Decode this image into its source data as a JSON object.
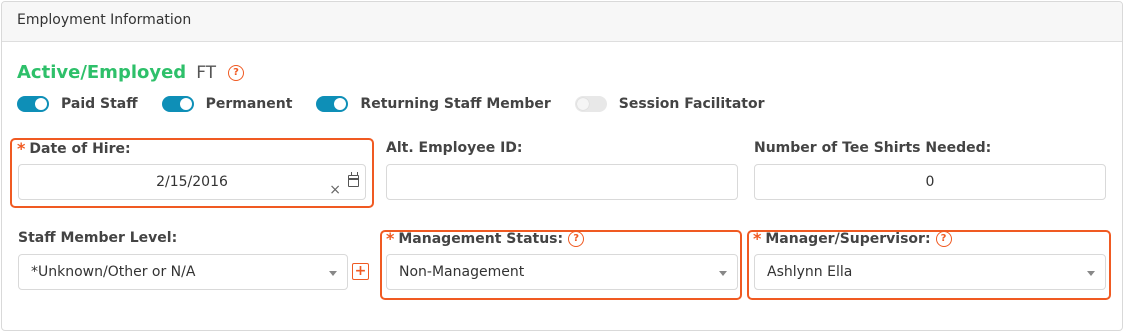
{
  "card": {
    "title": "Employment Information"
  },
  "status": {
    "main": "Active/Employed",
    "type": "FT",
    "help_icon": "question-circle-icon"
  },
  "toggles": [
    {
      "label": "Paid Staff",
      "on": true
    },
    {
      "label": "Permanent",
      "on": true
    },
    {
      "label": "Returning Staff Member",
      "on": true
    },
    {
      "label": "Session Facilitator",
      "on": false
    }
  ],
  "fields": {
    "date_of_hire": {
      "label": "Date of Hire:",
      "value": "2/15/2016",
      "clear": "×",
      "required": true
    },
    "alt_employee_id": {
      "label": "Alt. Employee ID:",
      "value": ""
    },
    "tee_shirts": {
      "label": "Number of Tee Shirts Needed:",
      "value": "0"
    },
    "staff_member_level": {
      "label": "Staff Member Level:",
      "value": "*Unknown/Other or N/A",
      "add_label": "+"
    },
    "management_status": {
      "label": "Management Status:",
      "value": "Non-Management",
      "required": true
    },
    "manager_supervisor": {
      "label": "Manager/Supervisor:",
      "value": "Ashlynn Ella",
      "required": true
    }
  },
  "required_marker": "*",
  "help_glyph": "?",
  "colors": {
    "accent": "#f05a22",
    "active_status": "#2ec06a",
    "toggle_on": "#0e8fb7"
  }
}
